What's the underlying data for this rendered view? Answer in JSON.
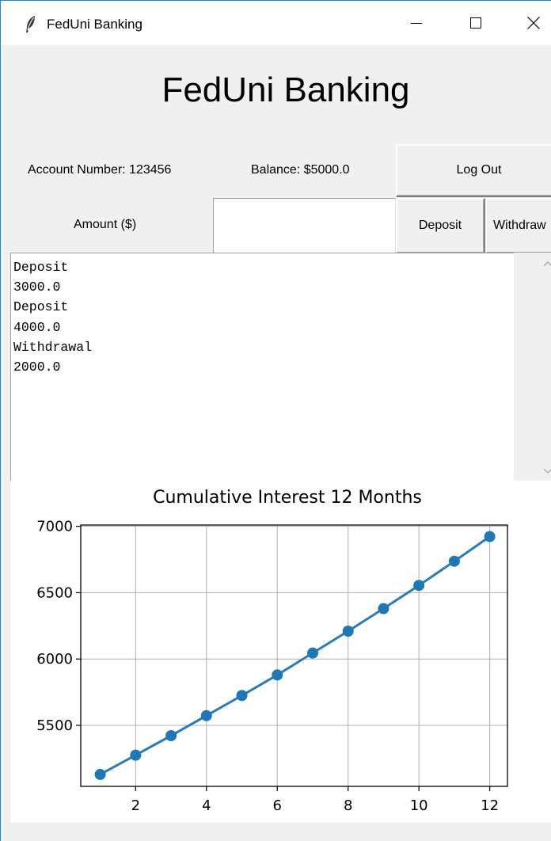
{
  "window": {
    "title": "FedUni Banking"
  },
  "header": {
    "app_title": "FedUni Banking"
  },
  "account": {
    "account_number_label": "Account Number: 123456",
    "balance_label": "Balance: $5000.0",
    "logout_label": "Log Out"
  },
  "transaction": {
    "amount_label": "Amount ($)",
    "amount_value": "",
    "deposit_label": "Deposit",
    "withdraw_label": "Withdraw"
  },
  "history": {
    "lines": [
      "Deposit",
      "3000.0",
      "Deposit",
      "4000.0",
      "Withdrawal",
      "2000.0"
    ]
  },
  "icons": {
    "app": "feather-icon",
    "minimize": "minimize-icon",
    "maximize": "maximize-icon",
    "close": "close-icon",
    "scroll_up": "chevron-up-icon",
    "scroll_down": "chevron-down-icon"
  },
  "colors": {
    "line": "#2c7bb6",
    "marker": "#1f77b4",
    "grid": "#b0b0b0",
    "window_border": "#1e89c6"
  },
  "chart_data": {
    "type": "line",
    "title": "Cumulative Interest 12 Months",
    "xlabel": "",
    "ylabel": "",
    "x": [
      1,
      2,
      3,
      4,
      5,
      6,
      7,
      8,
      9,
      10,
      11,
      12
    ],
    "y": [
      5130,
      5275,
      5422,
      5573,
      5725,
      5880,
      6045,
      6210,
      6380,
      6555,
      6737,
      6923
    ],
    "xticks": [
      2,
      4,
      6,
      8,
      10,
      12
    ],
    "yticks": [
      5500,
      6000,
      6500,
      7000
    ],
    "xlim": [
      0.45,
      12.5
    ],
    "ylim": [
      5040,
      7010
    ],
    "grid": true,
    "markers": true
  }
}
